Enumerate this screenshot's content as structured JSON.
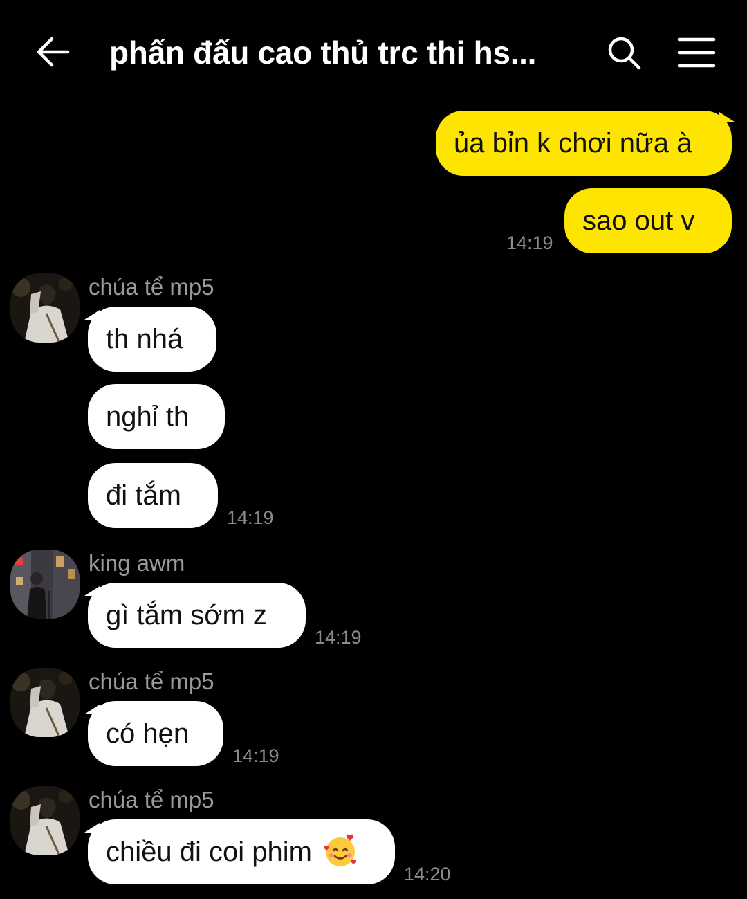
{
  "header": {
    "back_icon": "arrow-left-icon",
    "title": "phấn đấu cao thủ trc thi hs...",
    "search_icon": "search-icon",
    "menu_icon": "hamburger-menu-icon"
  },
  "colors": {
    "background": "#000000",
    "outgoing_bubble": "#fee500",
    "incoming_bubble": "#ffffff",
    "timestamp": "#8a8a8a",
    "sender_name": "#9a9a9a"
  },
  "messages": {
    "out1": {
      "text": "ủa bỉn k chơi nữa à"
    },
    "out2": {
      "text": "sao out v",
      "time": "14:19"
    },
    "group1": {
      "sender": "chúa tể mp5",
      "m1": "th nhá",
      "m2": "nghỉ th",
      "m3": "đi tắm",
      "time": "14:19"
    },
    "group2": {
      "sender": "king awm",
      "m1": "gì tắm sớm z",
      "time": "14:19"
    },
    "group3": {
      "sender": "chúa tể mp5",
      "m1": "có hẹn",
      "time": "14:19"
    },
    "group4": {
      "sender": "chúa tể mp5",
      "m1": "chiều đi coi phim",
      "emoji": "smiling-face-with-hearts-emoji",
      "time": "14:20"
    }
  }
}
